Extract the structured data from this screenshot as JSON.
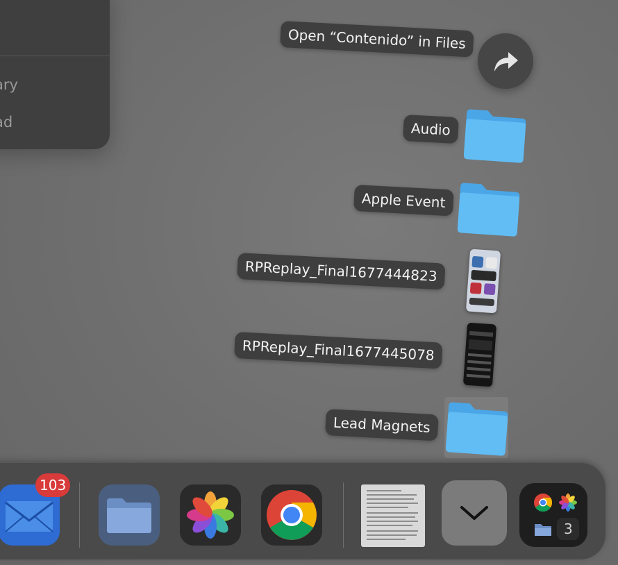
{
  "side_panel": {
    "row1": "ary",
    "row2": "ad"
  },
  "stack": {
    "open_label": "Open “Contenido” in Files",
    "items": [
      {
        "label": "Audio",
        "kind": "folder"
      },
      {
        "label": "Apple Event",
        "kind": "folder"
      },
      {
        "label": "RPReplay_Final1677444823",
        "kind": "screenshot"
      },
      {
        "label": "RPReplay_Final1677445078",
        "kind": "screenshot"
      },
      {
        "label": "Lead Magnets",
        "kind": "folder"
      }
    ]
  },
  "dock": {
    "mail_badge": "103",
    "calendar_day": "3",
    "icons": [
      "mail-icon",
      "files-icon",
      "photos-icon",
      "chrome-icon",
      "document-thumbnail",
      "chevron-down-icon",
      "app-library-icon"
    ]
  },
  "colors": {
    "folder_blue": "#5ab4f0",
    "badge_red": "#d93a3a"
  }
}
